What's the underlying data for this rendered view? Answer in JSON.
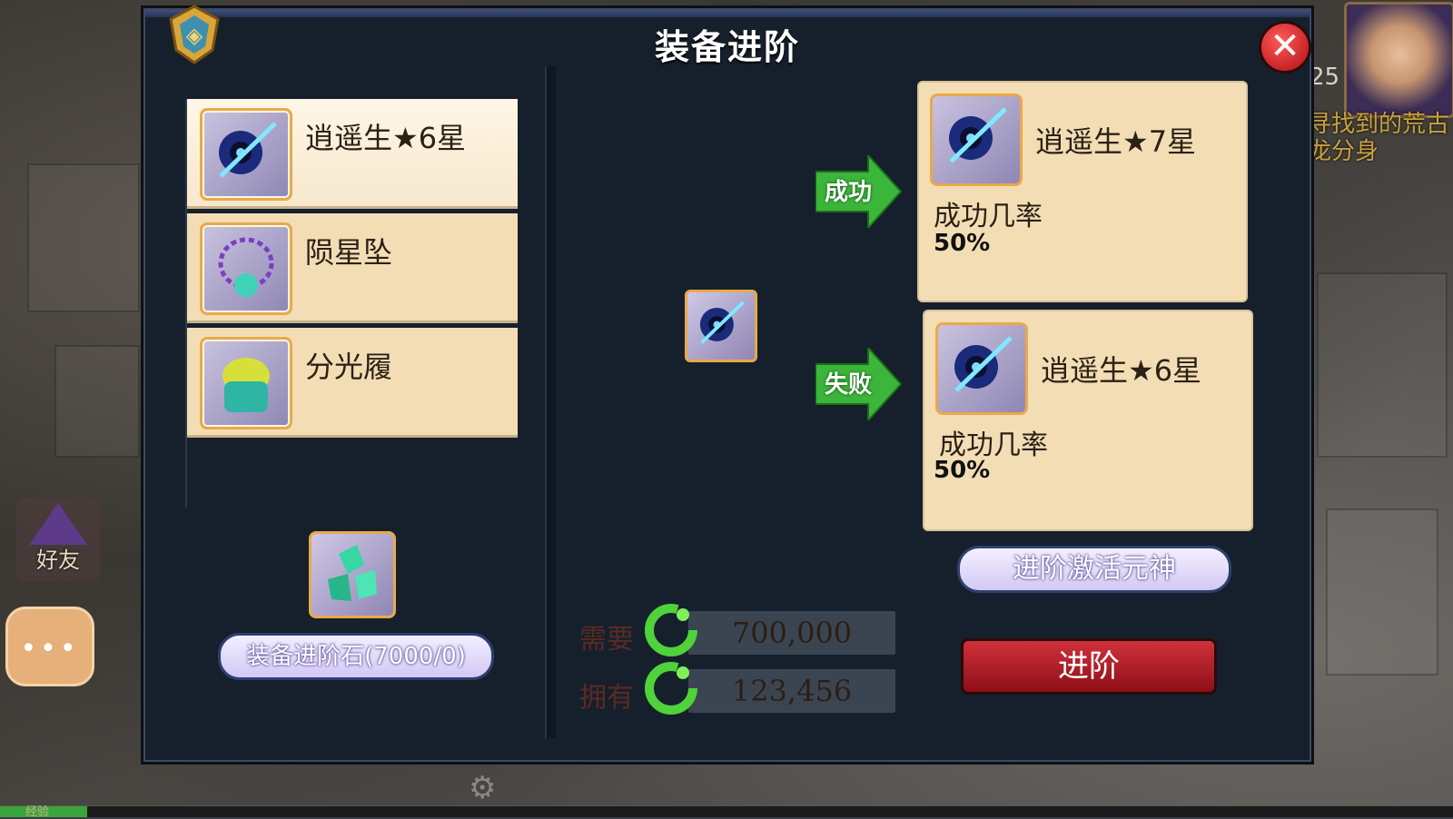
{
  "dialog": {
    "title": "装备进阶",
    "close_symbol": "✕"
  },
  "equipment_list": [
    {
      "name": "逍遥生★6星",
      "icon": "weapon-icon",
      "selected": true
    },
    {
      "name": "陨星坠",
      "icon": "necklace-icon",
      "selected": false
    },
    {
      "name": "分光履",
      "icon": "boots-icon",
      "selected": false
    }
  ],
  "material": {
    "icon": "advance-stone-icon",
    "label": "装备进阶石(7000/0)"
  },
  "center_item_icon": "weapon-icon",
  "outcomes": {
    "success": {
      "arrow_label": "成功",
      "item_name": "逍遥生★7星",
      "rate_label": "成功几率",
      "rate": "50%"
    },
    "failure": {
      "arrow_label": "失败",
      "item_name": "逍遥生★6星",
      "rate_label": "成功几率",
      "rate": "50%"
    }
  },
  "cost": {
    "need_label": "需要",
    "need_value": "700,000",
    "have_label": "拥有",
    "have_value": "123,456",
    "currency_icon": "green-dragon-coin-icon"
  },
  "buttons": {
    "activate": "进阶激活元神",
    "advance": "进阶"
  },
  "hud": {
    "friend_label": "好友",
    "avatar_level": "25",
    "side_text": [
      "寻找到的荒古",
      "龙分身"
    ],
    "exp_label": "经验",
    "exp_progress": 0.06
  },
  "colors": {
    "dialog_bg": "#16202c",
    "card_bg": "#f3ddb5",
    "advance_button": "#b5202a",
    "arrow_green": "#3bb53a"
  }
}
